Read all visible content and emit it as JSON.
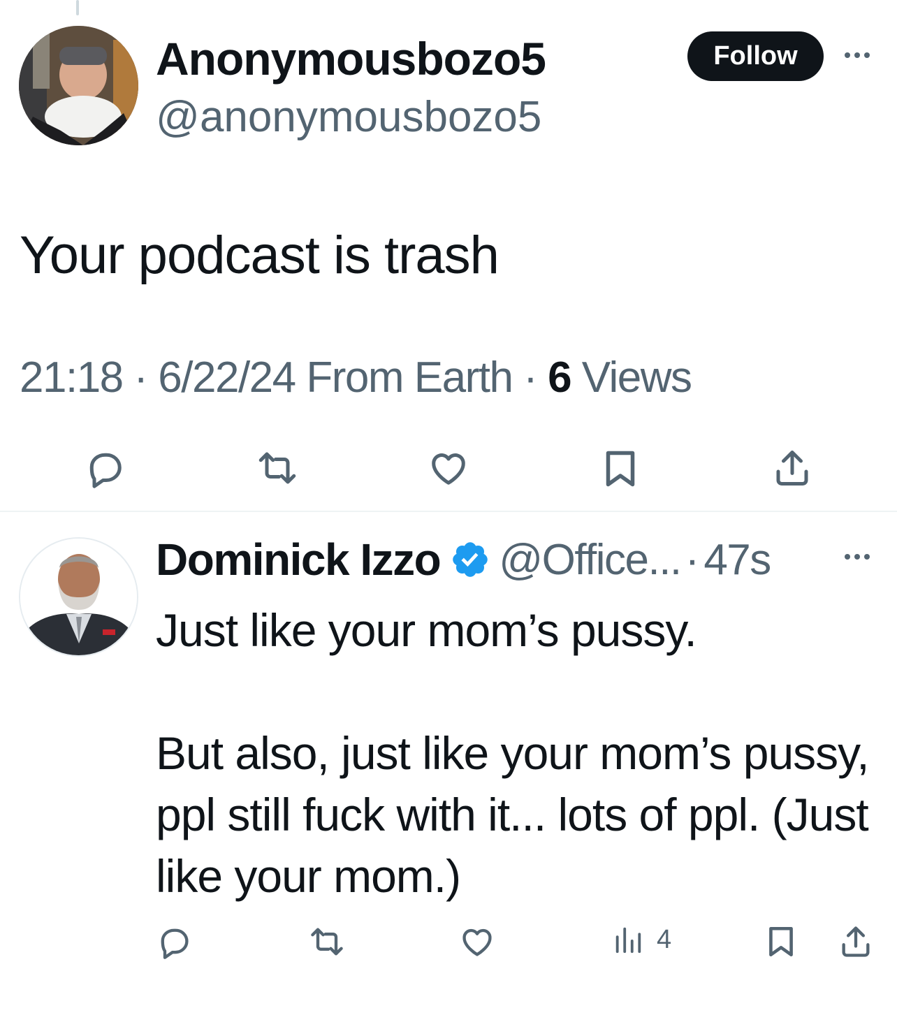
{
  "main_tweet": {
    "display_name": "Anonymousbozo5",
    "handle": "@anonymousbozo5",
    "follow_label": "Follow",
    "text": "Your podcast is trash",
    "time": "21:18",
    "date": "6/22/24",
    "source": "From Earth",
    "views_count": "6",
    "views_label": "Views",
    "separator": "·"
  },
  "reply_tweet": {
    "display_name": "Dominick Izzo",
    "handle": "@Office...",
    "separator": "·",
    "time_ago": "47s",
    "text_line1": "Just like your mom’s pussy.",
    "text_para2": "But also, just like your mom’s pussy, ppl still fuck with it... lots of ppl. (Just like your mom.)",
    "views": "4"
  },
  "colors": {
    "text_primary": "#0f1419",
    "text_secondary": "#536471",
    "verified_blue": "#1d9bf0",
    "follow_bg": "#0f1419"
  },
  "icons": {
    "reply": "reply-bubble-icon",
    "retweet": "retweet-icon",
    "like": "heart-icon",
    "bookmark": "bookmark-icon",
    "share": "share-icon",
    "views": "bar-chart-icon",
    "verified": "verified-badge-icon",
    "more": "more-dots-icon"
  }
}
